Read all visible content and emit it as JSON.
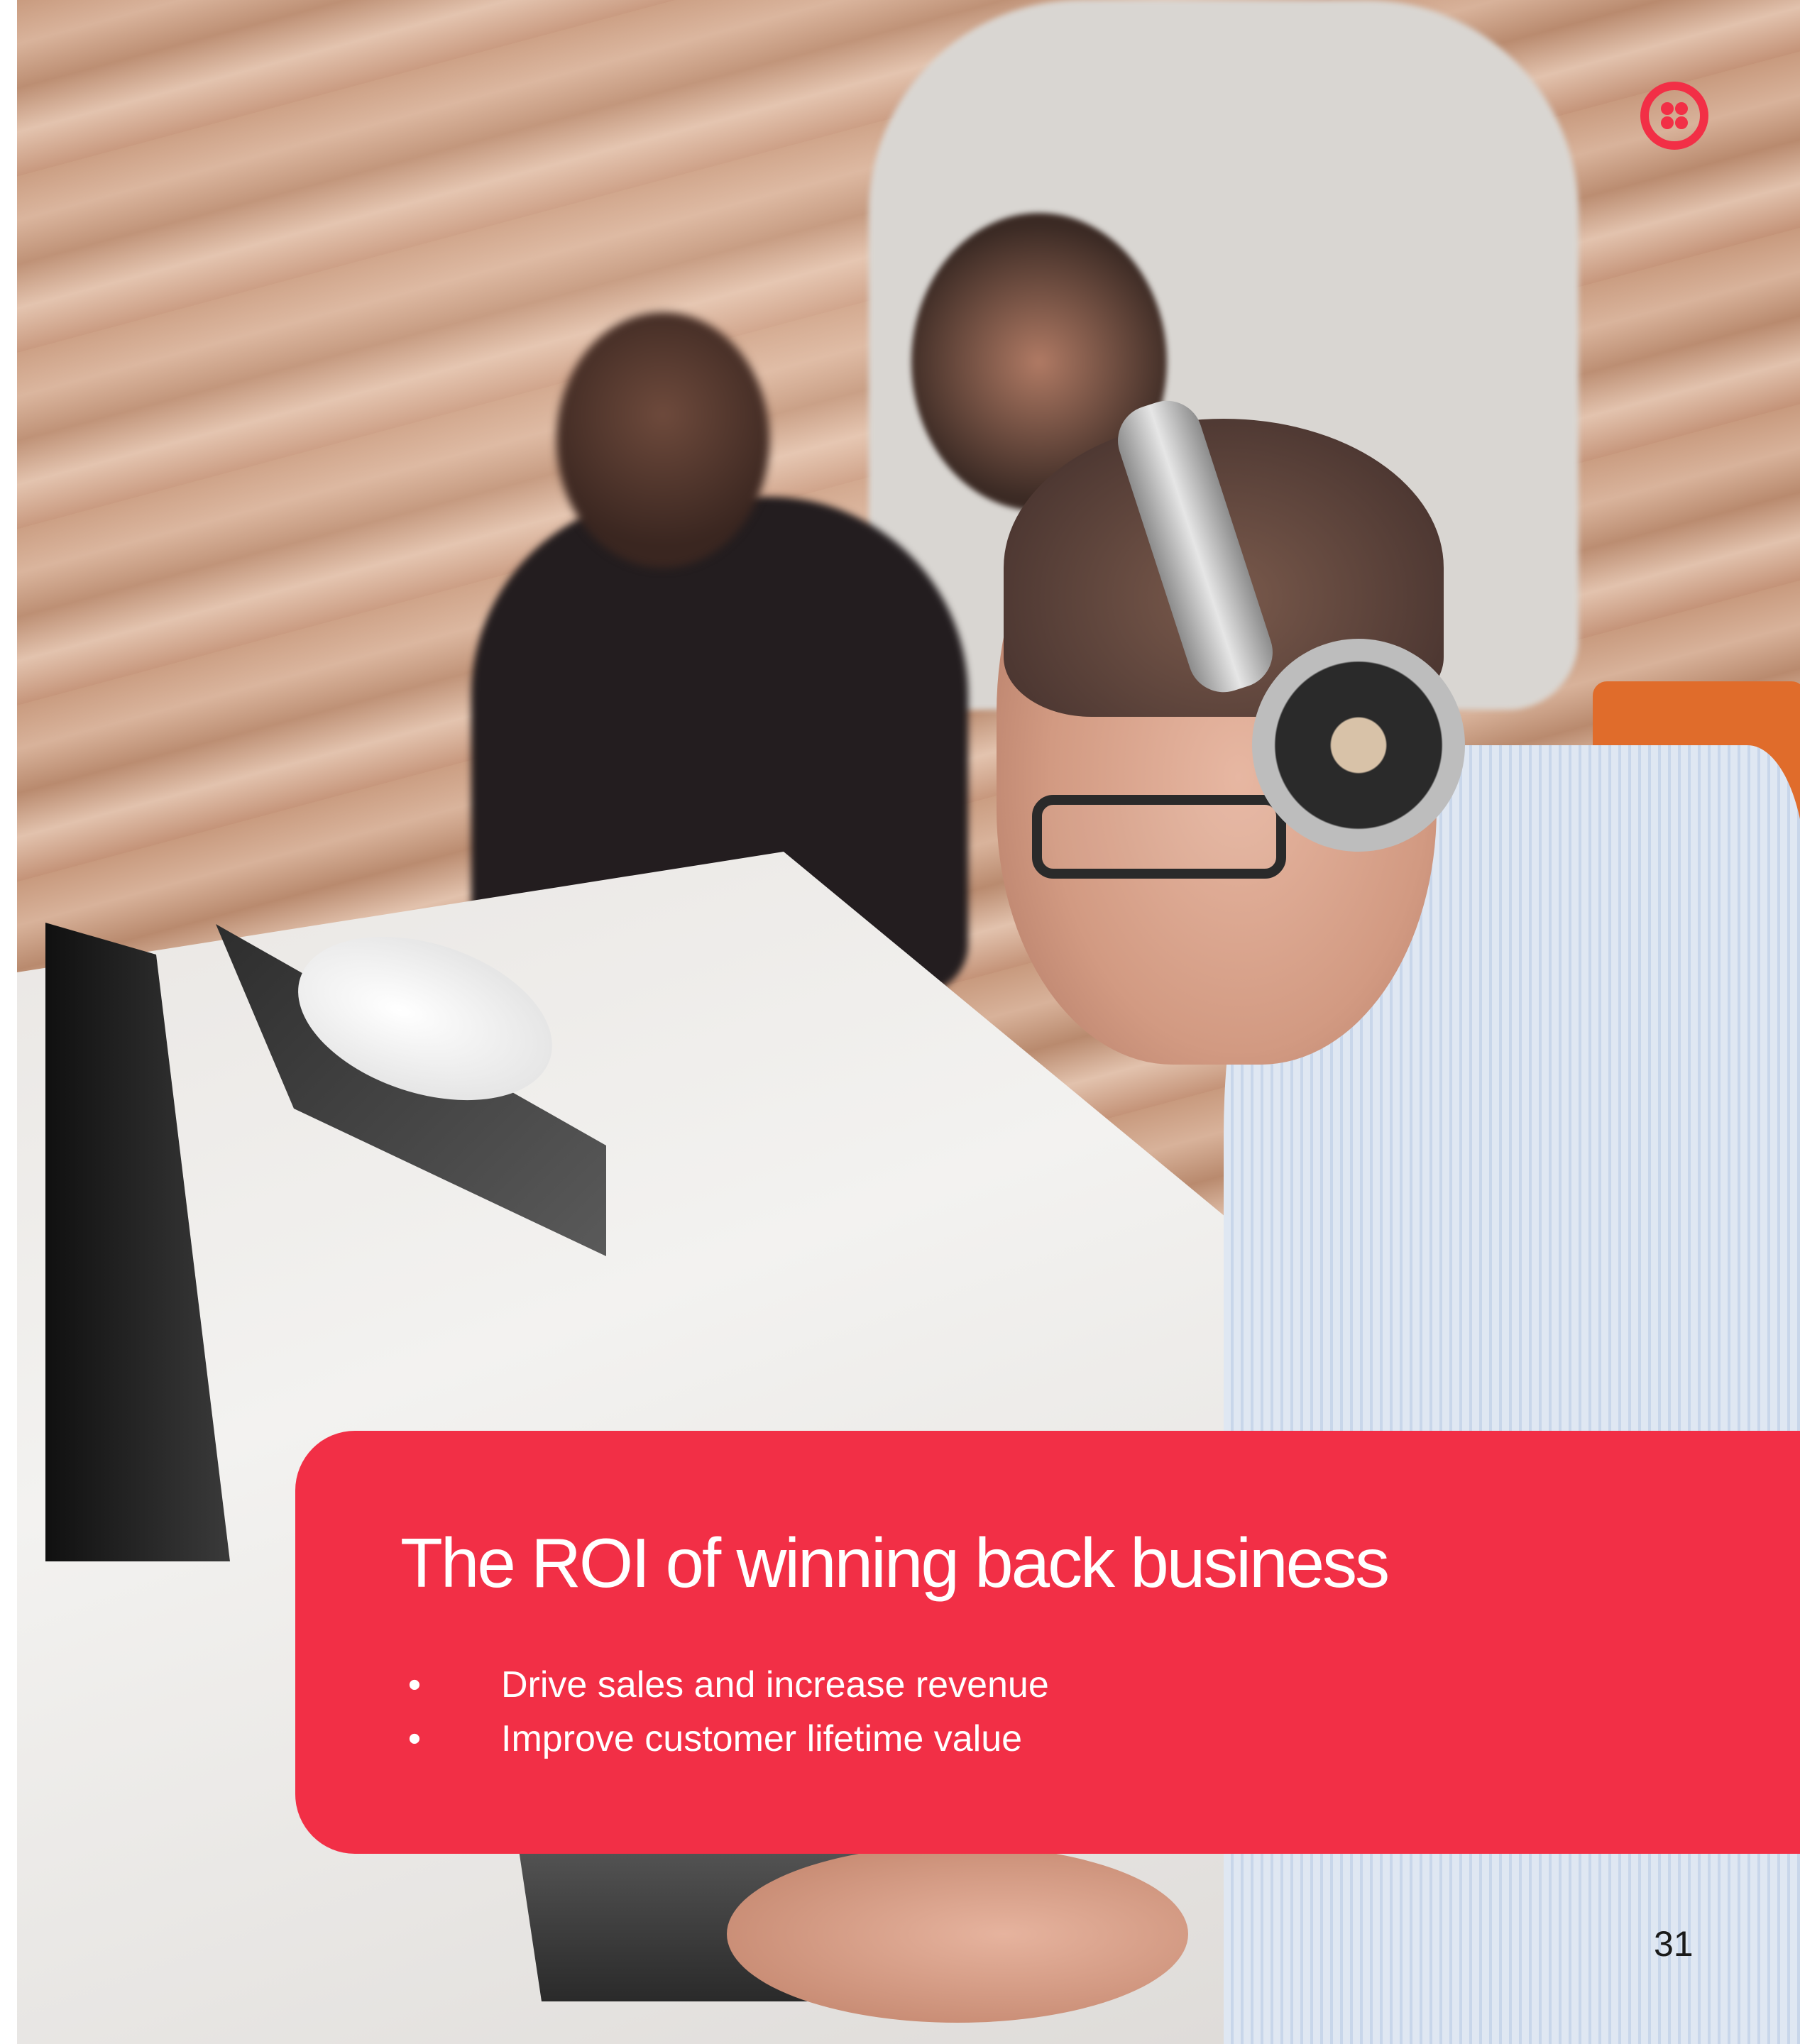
{
  "logo": {
    "icon": "twilio-logo-icon",
    "color": "#f22f46"
  },
  "callout": {
    "title": "The ROI of winning back business",
    "background_color": "#f22f46",
    "bullets": [
      {
        "marker": "•",
        "text": "Drive sales and increase revenue"
      },
      {
        "marker": "•",
        "text": "Improve customer lifetime value"
      }
    ]
  },
  "page_number": "31"
}
